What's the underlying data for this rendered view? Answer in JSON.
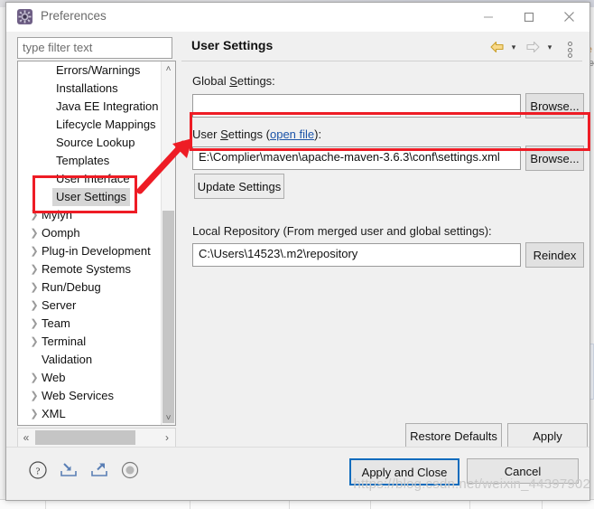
{
  "window": {
    "title": "Preferences",
    "icon": "preferences-gear-icon",
    "controls": {
      "minimize": "—",
      "maximize": "□",
      "close": "✕"
    }
  },
  "filter": {
    "placeholder": "type filter text",
    "value": ""
  },
  "tree": {
    "items": [
      {
        "label": "Errors/Warnings",
        "expandable": false,
        "indent": 1,
        "selected": false
      },
      {
        "label": "Installations",
        "expandable": false,
        "indent": 1,
        "selected": false
      },
      {
        "label": "Java EE Integration",
        "expandable": false,
        "indent": 1,
        "selected": false
      },
      {
        "label": "Lifecycle Mappings",
        "expandable": false,
        "indent": 1,
        "selected": false
      },
      {
        "label": "Source Lookup",
        "expandable": false,
        "indent": 1,
        "selected": false
      },
      {
        "label": "Templates",
        "expandable": false,
        "indent": 1,
        "selected": false
      },
      {
        "label": "User Interface",
        "expandable": false,
        "indent": 1,
        "selected": false
      },
      {
        "label": "User Settings",
        "expandable": false,
        "indent": 1,
        "selected": true
      },
      {
        "label": "Mylyn",
        "expandable": true,
        "indent": 0,
        "selected": false
      },
      {
        "label": "Oomph",
        "expandable": true,
        "indent": 0,
        "selected": false
      },
      {
        "label": "Plug-in Development",
        "expandable": true,
        "indent": 0,
        "selected": false
      },
      {
        "label": "Remote Systems",
        "expandable": true,
        "indent": 0,
        "selected": false
      },
      {
        "label": "Run/Debug",
        "expandable": true,
        "indent": 0,
        "selected": false
      },
      {
        "label": "Server",
        "expandable": true,
        "indent": 0,
        "selected": false
      },
      {
        "label": "Team",
        "expandable": true,
        "indent": 0,
        "selected": false
      },
      {
        "label": "Terminal",
        "expandable": true,
        "indent": 0,
        "selected": false
      },
      {
        "label": "Validation",
        "expandable": false,
        "indent": 0,
        "selected": false
      },
      {
        "label": "Web",
        "expandable": true,
        "indent": 0,
        "selected": false
      },
      {
        "label": "Web Services",
        "expandable": true,
        "indent": 0,
        "selected": false
      },
      {
        "label": "XML",
        "expandable": true,
        "indent": 0,
        "selected": false
      }
    ],
    "scroll_up_glyph": "˄",
    "scroll_down_glyph": "˅",
    "scroll_left_glyph": "«",
    "scroll_right_glyph": "›"
  },
  "page": {
    "title": "User Settings",
    "nav": {
      "back": "back-arrow-icon",
      "forward": "forward-arrow-icon",
      "menu": "view-menu-icon",
      "chevron": "▾"
    },
    "global_settings": {
      "label_before": "Global ",
      "label_accel": "S",
      "label_after": "ettings:",
      "value": "",
      "browse_label": "Browse..."
    },
    "user_settings": {
      "label_before": "User ",
      "label_accel": "S",
      "label_mid": "ettings (",
      "link": "open file",
      "label_after": "):",
      "value": "E:\\Complier\\maven\\apache-maven-3.6.3\\conf\\settings.xml",
      "browse_label": "Browse...",
      "update_label": "Update Settings"
    },
    "local_repository": {
      "label": "Local Repository (From merged user and global settings):",
      "value": "C:\\Users\\14523\\.m2\\repository",
      "reindex_label": "Reindex"
    },
    "restore_defaults_label": "Restore Defaults",
    "apply_label": "Apply"
  },
  "footer": {
    "help": "help-icon",
    "import": "import-icon",
    "export": "export-icon",
    "record": "record-icon",
    "apply_and_close_label": "Apply and Close",
    "cancel_label": "Cancel"
  },
  "annotations": {
    "colors": {
      "highlight": "#ee1c25",
      "accent": "#0f6cbd",
      "link": "#1b53a8"
    },
    "arrow": "red-annotation-arrow"
  },
  "watermark": {
    "text": "https://blog.csdn.net/weixin_44397902"
  }
}
